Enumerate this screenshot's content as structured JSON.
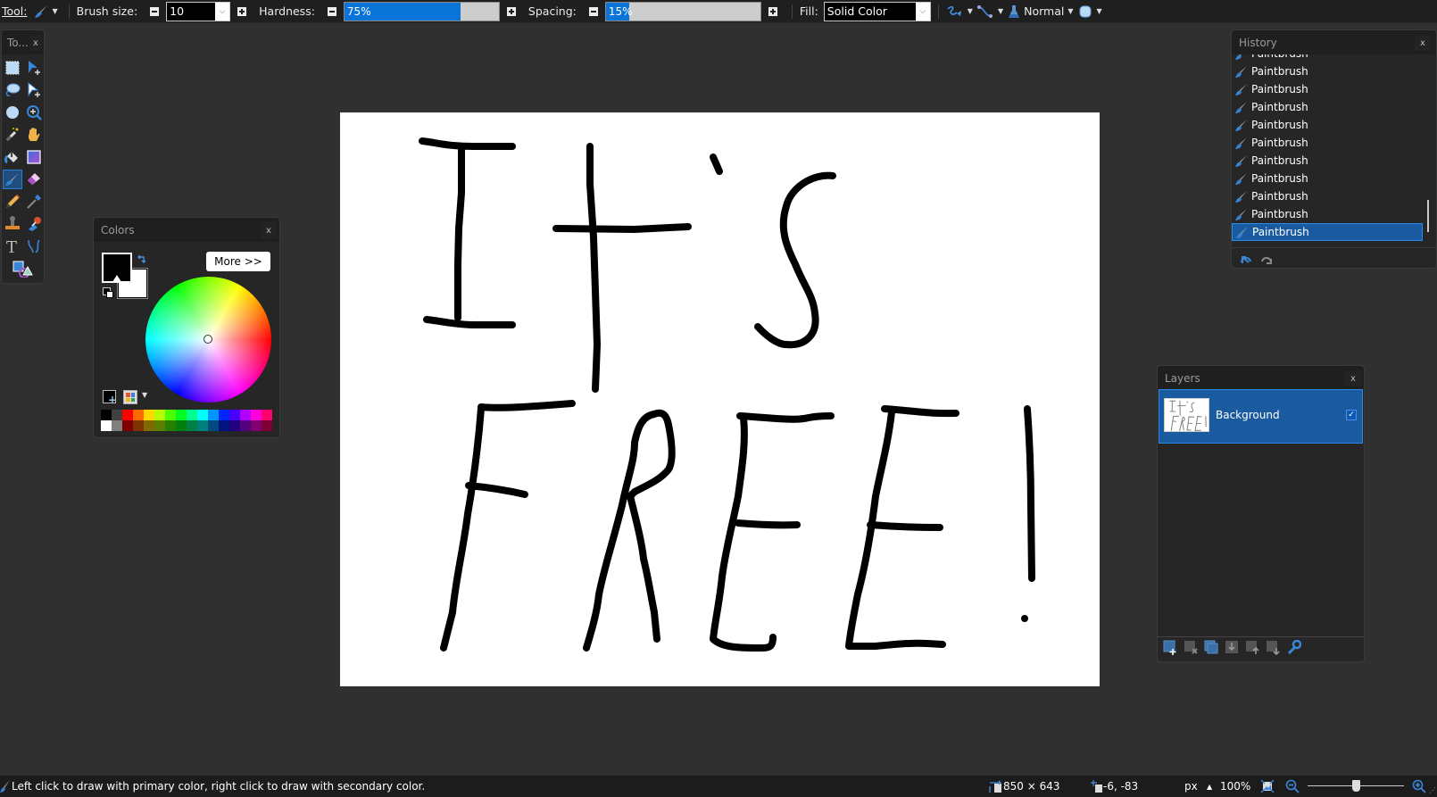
{
  "toolbar": {
    "tool_label": "Tool:",
    "brush_size_label": "Brush size:",
    "brush_size_value": "10",
    "hardness_label": "Hardness:",
    "hardness_value": "75%",
    "hardness_percent": 75,
    "spacing_label": "Spacing:",
    "spacing_value": "15%",
    "spacing_percent": 15,
    "fill_label": "Fill:",
    "fill_value": "Solid Color",
    "blend_mode": "Normal"
  },
  "tools_panel": {
    "title": "To...",
    "close": "x",
    "tools": [
      "rectangle-select",
      "move-selected-pixels",
      "lasso-select",
      "move-selection",
      "ellipse-select",
      "zoom",
      "magic-wand",
      "pan",
      "paint-bucket",
      "gradient",
      "paintbrush",
      "eraser",
      "pencil",
      "color-picker",
      "clone-stamp",
      "recolor",
      "text",
      "line-curve",
      "shapes"
    ],
    "active_tool": "paintbrush"
  },
  "colors_panel": {
    "title": "Colors",
    "close": "x",
    "more_button": "More >>",
    "primary_color": "#000000",
    "secondary_color": "#ffffff",
    "palette_top": [
      "#000000",
      "#404040",
      "#ff0000",
      "#ff6a00",
      "#ffd800",
      "#b6ff00",
      "#4cff00",
      "#00ff21",
      "#00ff90",
      "#00ffff",
      "#0094ff",
      "#0026ff",
      "#4800ff",
      "#b200ff",
      "#ff00dc",
      "#ff006e"
    ],
    "palette_bottom": [
      "#ffffff",
      "#808080",
      "#7f0000",
      "#7f3300",
      "#7f6a00",
      "#5b7f00",
      "#267f00",
      "#007f0e",
      "#007f46",
      "#007f7f",
      "#004a7f",
      "#00137f",
      "#21007f",
      "#57007f",
      "#7f006e",
      "#7f0037"
    ]
  },
  "history_panel": {
    "title": "History",
    "close": "x",
    "items": [
      "Paintbrush",
      "Paintbrush",
      "Paintbrush",
      "Paintbrush",
      "Paintbrush",
      "Paintbrush",
      "Paintbrush",
      "Paintbrush",
      "Paintbrush",
      "Paintbrush",
      "Paintbrush"
    ],
    "selected_index": 10,
    "undo": "undo-icon",
    "redo": "redo-icon"
  },
  "layers_panel": {
    "title": "Layers",
    "close": "x",
    "layers": [
      {
        "name": "Background",
        "visible": true,
        "selected": true,
        "thumbnail_text": "It's FREE!"
      }
    ],
    "buttons": [
      "add-new-layer",
      "delete-layer",
      "duplicate-layer",
      "merge-layer-down",
      "move-layer-up",
      "move-layer-down",
      "layer-properties"
    ]
  },
  "canvas": {
    "drawn_text": "It's FREE!",
    "background": "#ffffff"
  },
  "statusbar": {
    "hint": "Left click to draw with primary color, right click to draw with secondary color.",
    "image_size": "850 × 643",
    "cursor_position": "-6, -83",
    "units": "px",
    "zoom": "100%",
    "zoom_slider_percent": 50
  },
  "colors": {
    "accent": "#1a5ba0",
    "accent_border": "#2c8ae6",
    "slider_fill": "#0b74d8"
  }
}
